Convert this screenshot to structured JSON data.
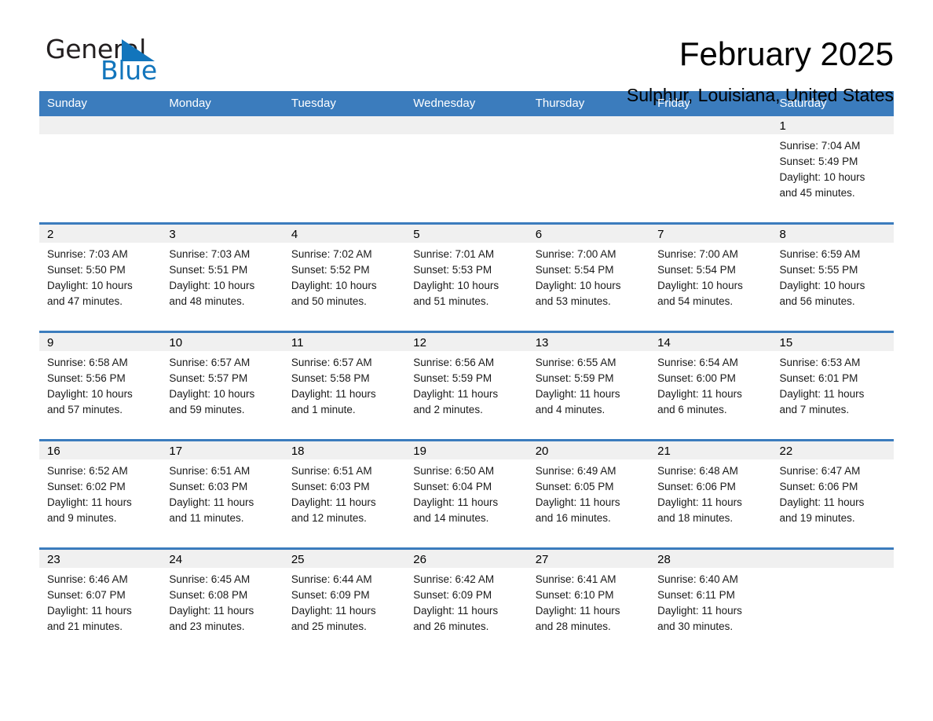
{
  "brand": {
    "name_part1": "General",
    "name_part2": "Blue",
    "logo_icon": "triangle-logo-icon",
    "accent_color": "#1275bc"
  },
  "header": {
    "month_title": "February 2025",
    "location": "Sulphur, Louisiana, United States"
  },
  "calendar": {
    "header_background": "#3b7cbd",
    "daynum_band_background": "#f0f0f0",
    "weekday_headers": [
      "Sunday",
      "Monday",
      "Tuesday",
      "Wednesday",
      "Thursday",
      "Friday",
      "Saturday"
    ],
    "weeks": [
      [
        {
          "day": "",
          "sunrise": "",
          "sunset": "",
          "daylight_line1": "",
          "daylight_line2": ""
        },
        {
          "day": "",
          "sunrise": "",
          "sunset": "",
          "daylight_line1": "",
          "daylight_line2": ""
        },
        {
          "day": "",
          "sunrise": "",
          "sunset": "",
          "daylight_line1": "",
          "daylight_line2": ""
        },
        {
          "day": "",
          "sunrise": "",
          "sunset": "",
          "daylight_line1": "",
          "daylight_line2": ""
        },
        {
          "day": "",
          "sunrise": "",
          "sunset": "",
          "daylight_line1": "",
          "daylight_line2": ""
        },
        {
          "day": "",
          "sunrise": "",
          "sunset": "",
          "daylight_line1": "",
          "daylight_line2": ""
        },
        {
          "day": "1",
          "sunrise": "Sunrise: 7:04 AM",
          "sunset": "Sunset: 5:49 PM",
          "daylight_line1": "Daylight: 10 hours",
          "daylight_line2": "and 45 minutes."
        }
      ],
      [
        {
          "day": "2",
          "sunrise": "Sunrise: 7:03 AM",
          "sunset": "Sunset: 5:50 PM",
          "daylight_line1": "Daylight: 10 hours",
          "daylight_line2": "and 47 minutes."
        },
        {
          "day": "3",
          "sunrise": "Sunrise: 7:03 AM",
          "sunset": "Sunset: 5:51 PM",
          "daylight_line1": "Daylight: 10 hours",
          "daylight_line2": "and 48 minutes."
        },
        {
          "day": "4",
          "sunrise": "Sunrise: 7:02 AM",
          "sunset": "Sunset: 5:52 PM",
          "daylight_line1": "Daylight: 10 hours",
          "daylight_line2": "and 50 minutes."
        },
        {
          "day": "5",
          "sunrise": "Sunrise: 7:01 AM",
          "sunset": "Sunset: 5:53 PM",
          "daylight_line1": "Daylight: 10 hours",
          "daylight_line2": "and 51 minutes."
        },
        {
          "day": "6",
          "sunrise": "Sunrise: 7:00 AM",
          "sunset": "Sunset: 5:54 PM",
          "daylight_line1": "Daylight: 10 hours",
          "daylight_line2": "and 53 minutes."
        },
        {
          "day": "7",
          "sunrise": "Sunrise: 7:00 AM",
          "sunset": "Sunset: 5:54 PM",
          "daylight_line1": "Daylight: 10 hours",
          "daylight_line2": "and 54 minutes."
        },
        {
          "day": "8",
          "sunrise": "Sunrise: 6:59 AM",
          "sunset": "Sunset: 5:55 PM",
          "daylight_line1": "Daylight: 10 hours",
          "daylight_line2": "and 56 minutes."
        }
      ],
      [
        {
          "day": "9",
          "sunrise": "Sunrise: 6:58 AM",
          "sunset": "Sunset: 5:56 PM",
          "daylight_line1": "Daylight: 10 hours",
          "daylight_line2": "and 57 minutes."
        },
        {
          "day": "10",
          "sunrise": "Sunrise: 6:57 AM",
          "sunset": "Sunset: 5:57 PM",
          "daylight_line1": "Daylight: 10 hours",
          "daylight_line2": "and 59 minutes."
        },
        {
          "day": "11",
          "sunrise": "Sunrise: 6:57 AM",
          "sunset": "Sunset: 5:58 PM",
          "daylight_line1": "Daylight: 11 hours",
          "daylight_line2": "and 1 minute."
        },
        {
          "day": "12",
          "sunrise": "Sunrise: 6:56 AM",
          "sunset": "Sunset: 5:59 PM",
          "daylight_line1": "Daylight: 11 hours",
          "daylight_line2": "and 2 minutes."
        },
        {
          "day": "13",
          "sunrise": "Sunrise: 6:55 AM",
          "sunset": "Sunset: 5:59 PM",
          "daylight_line1": "Daylight: 11 hours",
          "daylight_line2": "and 4 minutes."
        },
        {
          "day": "14",
          "sunrise": "Sunrise: 6:54 AM",
          "sunset": "Sunset: 6:00 PM",
          "daylight_line1": "Daylight: 11 hours",
          "daylight_line2": "and 6 minutes."
        },
        {
          "day": "15",
          "sunrise": "Sunrise: 6:53 AM",
          "sunset": "Sunset: 6:01 PM",
          "daylight_line1": "Daylight: 11 hours",
          "daylight_line2": "and 7 minutes."
        }
      ],
      [
        {
          "day": "16",
          "sunrise": "Sunrise: 6:52 AM",
          "sunset": "Sunset: 6:02 PM",
          "daylight_line1": "Daylight: 11 hours",
          "daylight_line2": "and 9 minutes."
        },
        {
          "day": "17",
          "sunrise": "Sunrise: 6:51 AM",
          "sunset": "Sunset: 6:03 PM",
          "daylight_line1": "Daylight: 11 hours",
          "daylight_line2": "and 11 minutes."
        },
        {
          "day": "18",
          "sunrise": "Sunrise: 6:51 AM",
          "sunset": "Sunset: 6:03 PM",
          "daylight_line1": "Daylight: 11 hours",
          "daylight_line2": "and 12 minutes."
        },
        {
          "day": "19",
          "sunrise": "Sunrise: 6:50 AM",
          "sunset": "Sunset: 6:04 PM",
          "daylight_line1": "Daylight: 11 hours",
          "daylight_line2": "and 14 minutes."
        },
        {
          "day": "20",
          "sunrise": "Sunrise: 6:49 AM",
          "sunset": "Sunset: 6:05 PM",
          "daylight_line1": "Daylight: 11 hours",
          "daylight_line2": "and 16 minutes."
        },
        {
          "day": "21",
          "sunrise": "Sunrise: 6:48 AM",
          "sunset": "Sunset: 6:06 PM",
          "daylight_line1": "Daylight: 11 hours",
          "daylight_line2": "and 18 minutes."
        },
        {
          "day": "22",
          "sunrise": "Sunrise: 6:47 AM",
          "sunset": "Sunset: 6:06 PM",
          "daylight_line1": "Daylight: 11 hours",
          "daylight_line2": "and 19 minutes."
        }
      ],
      [
        {
          "day": "23",
          "sunrise": "Sunrise: 6:46 AM",
          "sunset": "Sunset: 6:07 PM",
          "daylight_line1": "Daylight: 11 hours",
          "daylight_line2": "and 21 minutes."
        },
        {
          "day": "24",
          "sunrise": "Sunrise: 6:45 AM",
          "sunset": "Sunset: 6:08 PM",
          "daylight_line1": "Daylight: 11 hours",
          "daylight_line2": "and 23 minutes."
        },
        {
          "day": "25",
          "sunrise": "Sunrise: 6:44 AM",
          "sunset": "Sunset: 6:09 PM",
          "daylight_line1": "Daylight: 11 hours",
          "daylight_line2": "and 25 minutes."
        },
        {
          "day": "26",
          "sunrise": "Sunrise: 6:42 AM",
          "sunset": "Sunset: 6:09 PM",
          "daylight_line1": "Daylight: 11 hours",
          "daylight_line2": "and 26 minutes."
        },
        {
          "day": "27",
          "sunrise": "Sunrise: 6:41 AM",
          "sunset": "Sunset: 6:10 PM",
          "daylight_line1": "Daylight: 11 hours",
          "daylight_line2": "and 28 minutes."
        },
        {
          "day": "28",
          "sunrise": "Sunrise: 6:40 AM",
          "sunset": "Sunset: 6:11 PM",
          "daylight_line1": "Daylight: 11 hours",
          "daylight_line2": "and 30 minutes."
        },
        {
          "day": "",
          "sunrise": "",
          "sunset": "",
          "daylight_line1": "",
          "daylight_line2": ""
        }
      ]
    ]
  }
}
